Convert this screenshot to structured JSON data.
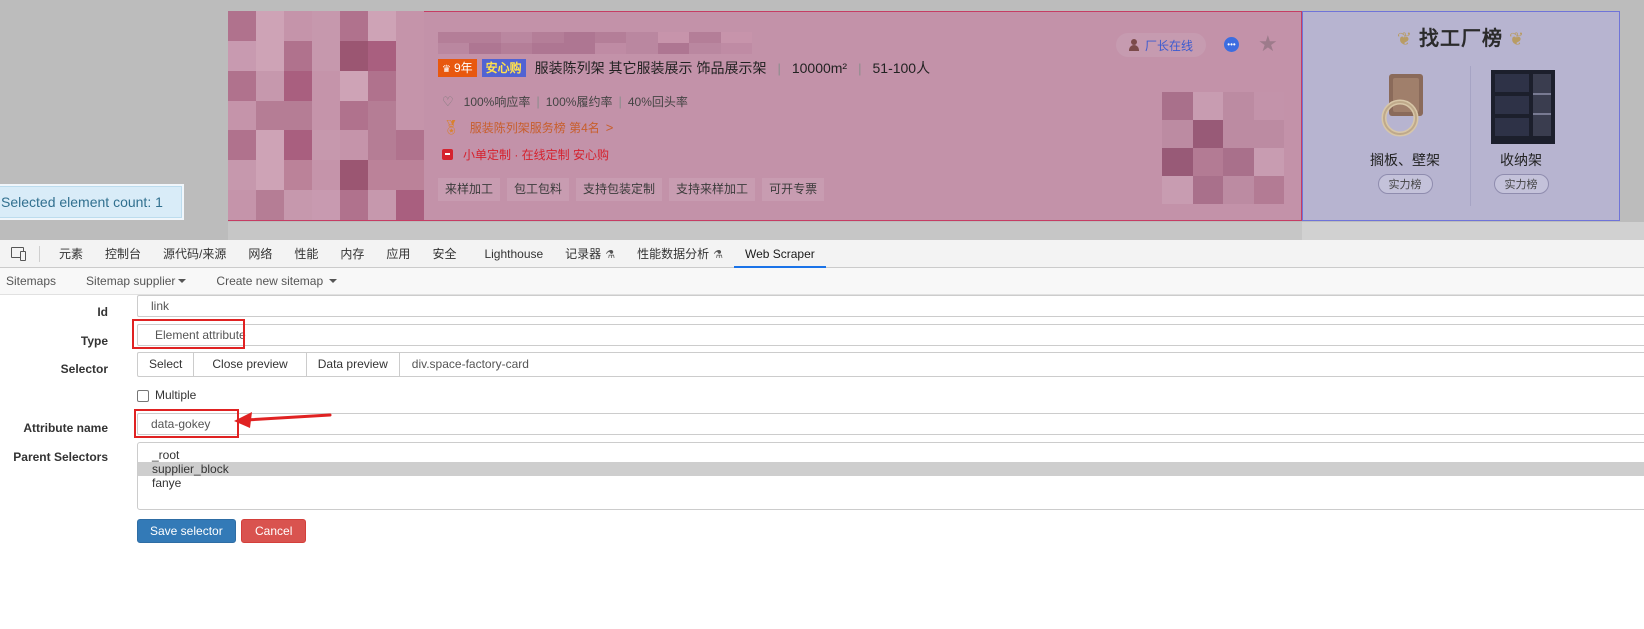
{
  "page": {
    "shop": {
      "badge_years": "9年",
      "badge_years_icon": "trophy-icon",
      "badge_safe": "安心购",
      "categories": "服装陈列架 其它服装展示 饰品展示架",
      "area": "10000m²",
      "staff": "51-100人",
      "stats": [
        "100%响应率",
        "100%履约率",
        "40%回头率"
      ],
      "rank_text": "服装陈列架服务榜 第4名",
      "custom_text": "小单定制 · 在线定制 安心购",
      "tags": [
        "来样加工",
        "包工包料",
        "支持包装定制",
        "支持来样加工",
        "可开专票"
      ],
      "online_label": "厂长在线",
      "icons": {
        "online": "person-icon",
        "chat": "chat-icon",
        "favorite": "star-icon"
      }
    },
    "rank_panel": {
      "title": "找工厂榜",
      "items": [
        {
          "name": "搁板、壁架",
          "badge": "实力榜"
        },
        {
          "name": "收纳架",
          "badge": "实力榜"
        }
      ]
    },
    "colors": {
      "highlight_pink": "#c392a9",
      "highlight_pink_border": "#c53d64",
      "highlight_blue": "#b7b4d0",
      "highlight_blue_border": "#6f74d8"
    }
  },
  "selected_count_label": "Selected element count: 1",
  "devtools": {
    "tabs": [
      {
        "label": "元素",
        "name": "tab-elements"
      },
      {
        "label": "控制台",
        "name": "tab-console"
      },
      {
        "label": "源代码/来源",
        "name": "tab-sources"
      },
      {
        "label": "网络",
        "name": "tab-network"
      },
      {
        "label": "性能",
        "name": "tab-performance"
      },
      {
        "label": "内存",
        "name": "tab-memory"
      },
      {
        "label": "应用",
        "name": "tab-application"
      },
      {
        "label": "安全",
        "name": "tab-security"
      },
      {
        "label": "Lighthouse",
        "name": "tab-lighthouse"
      },
      {
        "label": "记录器",
        "name": "tab-recorder",
        "flask": true
      },
      {
        "label": "性能数据分析",
        "name": "tab-performance-insights",
        "flask": true
      },
      {
        "label": "Web Scraper",
        "name": "tab-web-scraper",
        "active": true
      }
    ],
    "accent": "#1a73e8"
  },
  "scraper": {
    "nav": {
      "sitemaps": "Sitemaps",
      "sitemap_supplier": "Sitemap supplier",
      "create_new": "Create new sitemap"
    },
    "form": {
      "id_label": "Id",
      "id_value": "link",
      "type_label": "Type",
      "type_value": "Element attribute",
      "selector_label": "Selector",
      "select_btn": "Select",
      "close_preview_btn": "Close preview",
      "data_preview_btn": "Data preview",
      "selector_value": "div.space-factory-card",
      "multiple_label": "Multiple",
      "multiple_checked": false,
      "attribute_label": "Attribute name",
      "attribute_value": "data-gokey",
      "parent_label": "Parent Selectors",
      "parent_options": [
        "_root",
        "supplier_block",
        "fanye"
      ],
      "parent_selected": "supplier_block",
      "save_btn": "Save selector",
      "cancel_btn": "Cancel"
    },
    "colors": {
      "primary": "#337ab7",
      "danger": "#d9534f",
      "annotation_red": "#e02222"
    }
  }
}
